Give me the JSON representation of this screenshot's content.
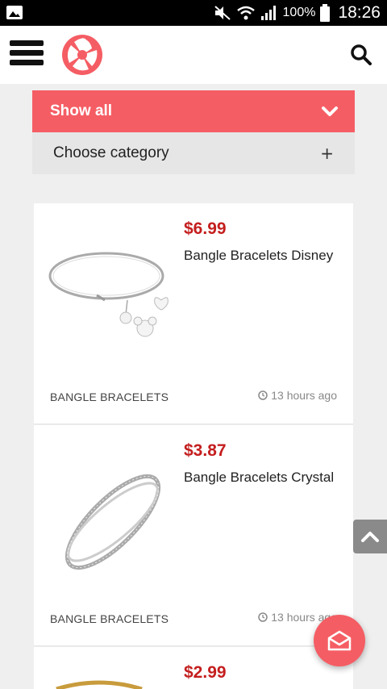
{
  "status_bar": {
    "battery_percent": "100%",
    "time": "18:26",
    "icons": [
      "gallery-icon",
      "mute-icon",
      "wifi-icon",
      "signal-icon",
      "battery-icon"
    ]
  },
  "app_bar": {
    "icons": [
      "menu-icon",
      "logo-icon",
      "search-icon"
    ],
    "brand_color": "#f55d64"
  },
  "filters": {
    "show_all_label": "Show all",
    "choose_category_label": "Choose category",
    "choose_category_expand": "+"
  },
  "products": [
    {
      "price": "$6.99",
      "title": "Bangle Bracelets Disney",
      "category": "BANGLE BRACELETS",
      "time": "13 hours ago"
    },
    {
      "price": "$3.87",
      "title": "Bangle Bracelets Crystal",
      "category": "BANGLE BRACELETS",
      "time": "13 hours ago"
    },
    {
      "price": "$2.99"
    }
  ],
  "colors": {
    "accent": "#f55d64",
    "price": "#c41e1e"
  }
}
